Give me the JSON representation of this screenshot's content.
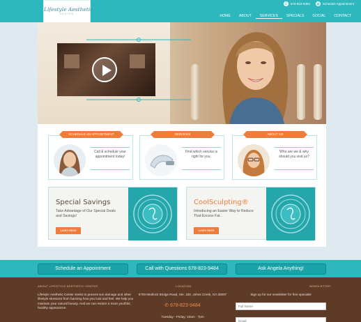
{
  "header": {
    "logo_main": "Lifestyle Aesthetic",
    "logo_sub": "CENTER",
    "phone": "678-823-9484",
    "schedule": "Schedule Appointment",
    "nav": [
      "HOME",
      "ABOUT",
      "SERVICES",
      "SPECIALS",
      "SOCIAL",
      "CONTACT"
    ],
    "nav_active": "SERVICES"
  },
  "boxes": [
    {
      "tag": "SCHEDULE AN APPOINTMENT",
      "text": "Call & schedule your appointment today!"
    },
    {
      "tag": "SERVICES",
      "text": "Find which service is right for you."
    },
    {
      "tag": "ABOUT US",
      "text": "Who are we & why should you visit us?"
    }
  ],
  "promos": [
    {
      "title": "Special Savings",
      "title_color": "#5b4a3c",
      "text": "Take Advantage of Our Special Deals and Savings!",
      "button": "Learn More"
    },
    {
      "title": "CoolSculpting®",
      "title_color": "#ee7d3b",
      "text": "Introducing an Easier Way to Reduce That Excess Fat.",
      "button": "Learn More"
    }
  ],
  "cta": [
    "Schedule an Appointment",
    "Call with Questions 678-823-9484",
    "Ask Angela Anything!"
  ],
  "footer": {
    "about_heading": "ABOUT LIFESTYLE AESTHETIC CENTER",
    "about_text": "Lifestyle Aesthetic Center seeks to prevent sun damage and other lifestyle stressors from harming how you look and feel. We help you maintain your natural beauty. And we can restore a more youthful, healthy appearance.",
    "location_heading": "LOCATION",
    "address": "9700 Medlock Bridge Road, Ste. 182, Johns Creek, GA 30097",
    "phone": "678-823-9484",
    "hours": "Tuesday - Friday: 10am - 7pm",
    "newsletter_heading": "NEWSLETTER",
    "signup": "Sign up for our newsletter for free specials!",
    "name_placeholder": "Full Name",
    "email_placeholder": "Email"
  },
  "colors": {
    "teal": "#2eb8bd",
    "orange": "#ee7d3b",
    "brown": "#5e3b26"
  }
}
